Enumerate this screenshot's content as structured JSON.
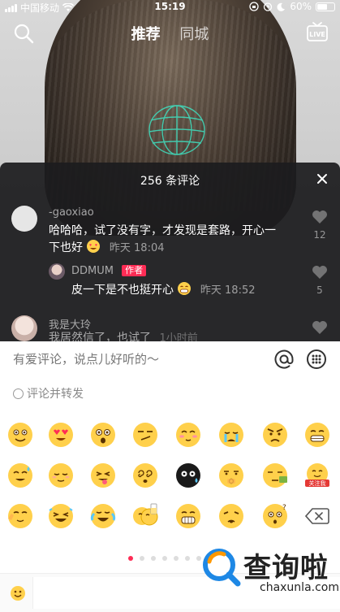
{
  "status_bar": {
    "carrier": "中国移动",
    "time": "15:19",
    "battery": "60%",
    "battery_level": 0.6
  },
  "nav": {
    "tabs": [
      {
        "label": "推荐",
        "active": true
      },
      {
        "label": "同城",
        "active": false
      }
    ],
    "live_label": "LIVE"
  },
  "comments_panel": {
    "title": "256 条评论",
    "comments": [
      {
        "user": "-gaoxiao",
        "text_line1": "哈哈哈，试了没有字，才发现是套路，开心一",
        "text_line2": "下也好",
        "time": "昨天 18:04",
        "likes": "12"
      },
      {
        "user": "DDMUM",
        "badge": "作者",
        "text": "皮一下是不也挺开心",
        "time": "昨天 18:52",
        "likes": "5"
      },
      {
        "user": "我是大玲",
        "text": "我居然信了，也试了",
        "time": "1小时前"
      }
    ]
  },
  "input": {
    "placeholder": "有爱评论，说点儿好听的～",
    "repost_label": "评论并转发"
  },
  "emoji_rows": [
    [
      "smile",
      "heart-eyes",
      "surprised",
      "smirk",
      "shy",
      "cry",
      "angry",
      "grin"
    ],
    [
      "sweat-smile",
      "content",
      "tongue",
      "dizzy",
      "black-face",
      "thinking",
      "money-face",
      "follow-me"
    ],
    [
      "point-up",
      "wink-laugh",
      "laugh-cry",
      "cheers",
      "bare-teeth",
      "tired",
      "question",
      "backspace"
    ]
  ],
  "follow_sticker_text": "关注我",
  "pager": {
    "pages": 8,
    "current": 0
  },
  "colors": {
    "accent": "#fe2c55",
    "emoji_yellow": "#ffd04b",
    "panel_bg": "#1c1c1e"
  },
  "watermark": {
    "text": "查询啦",
    "url": "chaxunla.com"
  }
}
